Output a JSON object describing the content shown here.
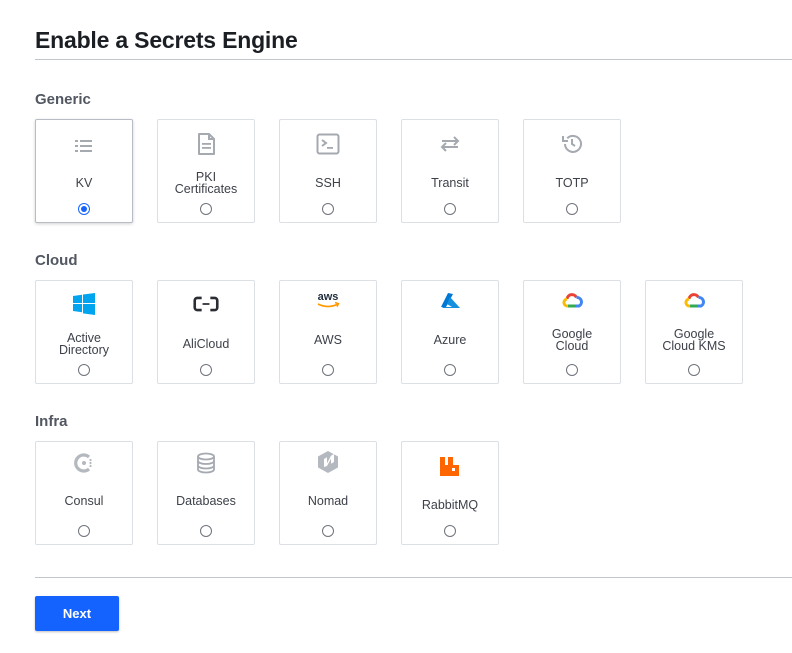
{
  "page": {
    "title": "Enable a Secrets Engine"
  },
  "sections": {
    "generic": {
      "label": "Generic",
      "items": [
        {
          "label": "KV",
          "icon": "list-icon",
          "selected": true
        },
        {
          "label": "PKI\nCertificates",
          "icon": "document-icon",
          "selected": false
        },
        {
          "label": "SSH",
          "icon": "terminal-icon",
          "selected": false
        },
        {
          "label": "Transit",
          "icon": "swap-arrows-icon",
          "selected": false
        },
        {
          "label": "TOTP",
          "icon": "history-clock-icon",
          "selected": false
        }
      ]
    },
    "cloud": {
      "label": "Cloud",
      "items": [
        {
          "label": "Active\nDirectory",
          "icon": "windows-logo-icon",
          "selected": false
        },
        {
          "label": "AliCloud",
          "icon": "alicloud-logo-icon",
          "selected": false
        },
        {
          "label": "AWS",
          "icon": "aws-logo-icon",
          "selected": false
        },
        {
          "label": "Azure",
          "icon": "azure-logo-icon",
          "selected": false
        },
        {
          "label": "Google\nCloud",
          "icon": "google-cloud-logo-icon",
          "selected": false
        },
        {
          "label": "Google\nCloud KMS",
          "icon": "google-cloud-logo-icon",
          "selected": false
        }
      ]
    },
    "infra": {
      "label": "Infra",
      "items": [
        {
          "label": "Consul",
          "icon": "consul-logo-icon",
          "selected": false
        },
        {
          "label": "Databases",
          "icon": "database-icon",
          "selected": false
        },
        {
          "label": "Nomad",
          "icon": "nomad-logo-icon",
          "selected": false
        },
        {
          "label": "RabbitMQ",
          "icon": "rabbitmq-logo-icon",
          "selected": false
        }
      ]
    }
  },
  "actions": {
    "next_label": "Next"
  },
  "colors": {
    "accent": "#1563ff",
    "aws_orange": "#ff9900",
    "azure_blue": "#0078d4",
    "rabbit_orange": "#ff6600",
    "windows_blue": "#00a4ef"
  }
}
